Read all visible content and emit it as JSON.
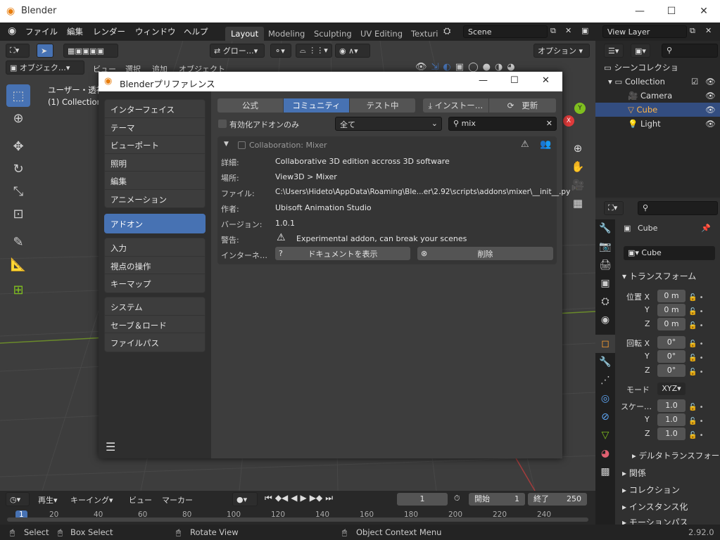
{
  "app": {
    "title": "Blender",
    "version": "2.92.0"
  },
  "menubar": [
    "ファイル",
    "編集",
    "レンダー",
    "ウィンドウ",
    "ヘルプ"
  ],
  "workspaces": [
    "Layout",
    "Modeling",
    "Sculpting",
    "UV Editing",
    "Texturi"
  ],
  "scene": "Scene",
  "view_layer": "View Layer",
  "viewport": {
    "transform_orientation": "グロー…",
    "options_label": "オプション",
    "mode": "オブジェク…",
    "header_menu": [
      "ビュー",
      "選択",
      "追加",
      "オブジェクト"
    ],
    "overlay_text_1": "ユーザー・透視",
    "overlay_text_2": "(1) Collection"
  },
  "dialog": {
    "title": "Blenderプリファレンス",
    "sidebar_groups": [
      [
        "インターフェイス",
        "テーマ",
        "ビューポート",
        "照明",
        "編集",
        "アニメーション"
      ],
      [
        "アドオン"
      ],
      [
        "入力",
        "視点の操作",
        "キーマップ"
      ],
      [
        "システム",
        "セーブ＆ロード",
        "ファイルパス"
      ]
    ],
    "tabs": [
      "公式",
      "コミュニティ",
      "テスト中"
    ],
    "install_label": "インストー…",
    "refresh_label": "更新",
    "enabled_only_label": "有効化アドオンのみ",
    "category": "全て",
    "search": "mix",
    "addon": {
      "name": "Collaboration: Mixer",
      "rows": [
        {
          "label": "詳細:",
          "value": "Collaborative 3D edition accross 3D software"
        },
        {
          "label": "場所:",
          "value": "View3D > Mixer"
        },
        {
          "label": "ファイル:",
          "value": "C:\\Users\\Hideto\\AppData\\Roaming\\Ble...er\\2.92\\scripts\\addons\\mixer\\__init__.py"
        },
        {
          "label": "作者:",
          "value": "Ubisoft Animation Studio"
        },
        {
          "label": "バージョン:",
          "value": "1.0.1"
        },
        {
          "label": "警告:",
          "value": "Experimental addon, can break your scenes"
        }
      ],
      "internet_label": "インターネ…",
      "docs_label": "ドキュメントを表示",
      "remove_label": "削除"
    }
  },
  "outliner": {
    "root": "シーンコレクショ",
    "collection": "Collection",
    "items": [
      "Camera",
      "Cube",
      "Light"
    ]
  },
  "properties": {
    "object_name": "Cube",
    "data_name": "Cube",
    "transform_label": "トランスフォーム",
    "location_label": "位置 X",
    "location": [
      "0 m",
      "0 m",
      "0 m"
    ],
    "rotation_label": "回転 X",
    "rotation": [
      "0°",
      "0°",
      "0°"
    ],
    "mode_label": "モード",
    "rotation_mode": "XYZ",
    "scale_label": "スケー…",
    "scale": [
      "1.0",
      "1.0",
      "1.0"
    ],
    "axes_yz": [
      "Y",
      "Z"
    ],
    "delta_label": "デルタトランスフォー",
    "sections": [
      "関係",
      "コレクション",
      "インスタンス化",
      "モーションパス"
    ]
  },
  "timeline": {
    "playback": "再生",
    "keying": "キーイング",
    "view": "ビュー",
    "marker": "マーカー",
    "current_frame": "1",
    "start_label": "開始",
    "start": "1",
    "end_label": "終了",
    "end": "250",
    "ruler": [
      "1",
      "20",
      "40",
      "60",
      "80",
      "100",
      "120",
      "140",
      "160",
      "180",
      "200",
      "220",
      "240"
    ]
  },
  "statusbar": [
    "Select",
    "Box Select",
    "Rotate View",
    "Object Context Menu"
  ],
  "colors": {
    "accent": "#4772b3",
    "active_tab": "#4772b3",
    "selected_row": "#334d80",
    "x_axis": "#e03b3b",
    "y_axis": "#7fbf1f"
  }
}
